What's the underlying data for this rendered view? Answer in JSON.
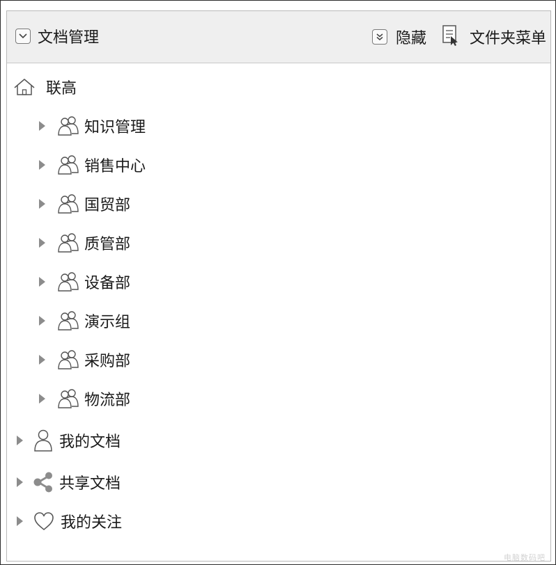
{
  "header": {
    "title": "文档管理",
    "title_icon": "chevron-down-icon",
    "hide_label": "隐藏",
    "hide_icon": "double-chevron-down-icon",
    "folder_menu_label": "文件夹菜单",
    "folder_menu_icon": "document-menu-icon"
  },
  "tree": {
    "root": {
      "label": "联高",
      "icon": "home-icon"
    },
    "groups": [
      {
        "label": "知识管理",
        "icon": "group-icon"
      },
      {
        "label": "销售中心",
        "icon": "group-icon"
      },
      {
        "label": "国贸部",
        "icon": "group-icon"
      },
      {
        "label": "质管部",
        "icon": "group-icon"
      },
      {
        "label": "设备部",
        "icon": "group-icon"
      },
      {
        "label": "演示组",
        "icon": "group-icon"
      },
      {
        "label": "采购部",
        "icon": "group-icon"
      },
      {
        "label": "物流部",
        "icon": "group-icon"
      }
    ],
    "sections": [
      {
        "label": "我的文档",
        "icon": "user-icon"
      },
      {
        "label": "共享文档",
        "icon": "share-icon"
      },
      {
        "label": "我的关注",
        "icon": "heart-icon"
      }
    ]
  },
  "colors": {
    "header_bg": "#efefef",
    "caret": "#8c8c8c",
    "icon_stroke": "#555555",
    "text": "#1a1a1a"
  },
  "watermark": "电脑数码吧"
}
